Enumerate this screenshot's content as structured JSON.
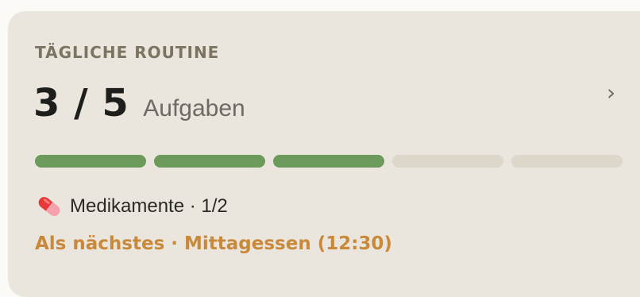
{
  "card": {
    "eyebrow": "TÄGLICHE ROUTINE",
    "count": "3 / 5",
    "count_unit": "Aufgaben",
    "chevron": "›",
    "progress": {
      "done": 3,
      "total": 5,
      "done_color": "#6b9a5a",
      "todo_color": "#dcd6cb"
    },
    "meds": {
      "icon": "pill-icon",
      "text": "Medikamente · 1/2"
    },
    "next": "Als nächstes · Mittagessen (12:30)"
  },
  "colors": {
    "card_background": "#ebe6dd",
    "accent_orange": "#c9893a"
  }
}
